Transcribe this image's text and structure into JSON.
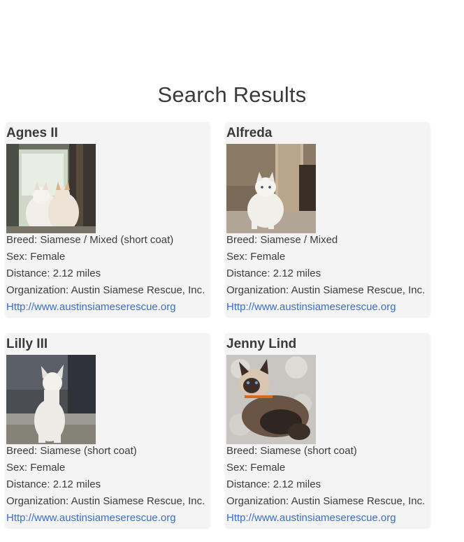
{
  "page": {
    "title": "Search Results"
  },
  "labels": {
    "breed": "Breed: ",
    "sex": "Sex: ",
    "distance": "Distance: ",
    "organization": "Organization: "
  },
  "results": [
    {
      "name": "Agnes II",
      "breed": "Siamese / Mixed (short coat)",
      "sex": "Female",
      "distance": "2.12 miles",
      "organization": "Austin Siamese Rescue, Inc.",
      "link": "Http://www.austinsiameserescue.org"
    },
    {
      "name": "Alfreda",
      "breed": "Siamese / Mixed",
      "sex": "Female",
      "distance": "2.12 miles",
      "organization": "Austin Siamese Rescue, Inc.",
      "link": "Http://www.austinsiameserescue.org"
    },
    {
      "name": "Lilly III",
      "breed": "Siamese (short coat)",
      "sex": "Female",
      "distance": "2.12 miles",
      "organization": "Austin Siamese Rescue, Inc.",
      "link": "Http://www.austinsiameserescue.org"
    },
    {
      "name": "Jenny Lind",
      "breed": "Siamese (short coat)",
      "sex": "Female",
      "distance": "2.12 miles",
      "organization": "Austin Siamese Rescue, Inc.",
      "link": "Http://www.austinsiameserescue.org"
    }
  ],
  "colors": {
    "card_background": "#f4f4f4",
    "link": "#3a6fc4",
    "text": "#3c3c3c"
  }
}
